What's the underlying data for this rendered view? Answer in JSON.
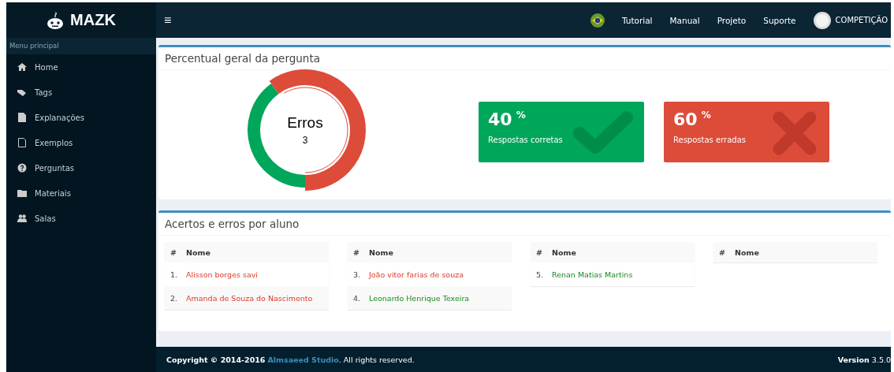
{
  "brand": "MAZK",
  "sidebar": {
    "header": "Menu principal",
    "items": [
      {
        "kind": "home",
        "label": "Home"
      },
      {
        "kind": "tags",
        "label": "Tags"
      },
      {
        "kind": "file",
        "label": "Explanações"
      },
      {
        "kind": "outline",
        "label": "Exemplos"
      },
      {
        "kind": "question",
        "label": "Perguntas"
      },
      {
        "kind": "folder",
        "label": "Materiais"
      },
      {
        "kind": "users",
        "label": "Salas"
      }
    ]
  },
  "topbar": {
    "menu_icon": "≡",
    "links": [
      "Tutorial",
      "Manual",
      "Projeto",
      "Suporte"
    ],
    "user": "COMPETIÇÃO"
  },
  "summary": {
    "title": "Percentual geral da pergunta",
    "donut": {
      "label": "Erros",
      "count": "3"
    },
    "stats": [
      {
        "kind": "correct",
        "value": "40",
        "unit": "%",
        "label": "Respostas corretas"
      },
      {
        "kind": "wrong",
        "value": "60",
        "unit": "%",
        "label": "Respostas erradas"
      }
    ]
  },
  "students": {
    "title": "Acertos e erros por aluno",
    "tables": [
      {
        "columns": [
          "#",
          "Nome"
        ],
        "rows": [
          {
            "number": "1.",
            "name": "Alisson borges savi",
            "correct": false
          },
          {
            "number": "2.",
            "name": "Amanda de Souza do Nascimento",
            "correct": false
          }
        ]
      },
      {
        "columns": [
          "#",
          "Nome"
        ],
        "rows": [
          {
            "number": "3.",
            "name": "João vitor farias de souza",
            "correct": false
          },
          {
            "number": "4.",
            "name": "Leonardo Henrique Texeira",
            "correct": true
          }
        ]
      },
      {
        "columns": [
          "#",
          "Nome"
        ],
        "rows": [
          {
            "number": "5.",
            "name": "Renan Matias Martins",
            "correct": true
          }
        ]
      },
      {
        "columns": [
          "#",
          "Nome"
        ]
      }
    ]
  },
  "footer": {
    "copyright": "**Copyright © 2014-2016**",
    "link": "Almsaeed Studio",
    "rest": ". All rights reserved.",
    "version_label": "Version",
    "version": "3.5.0"
  }
}
